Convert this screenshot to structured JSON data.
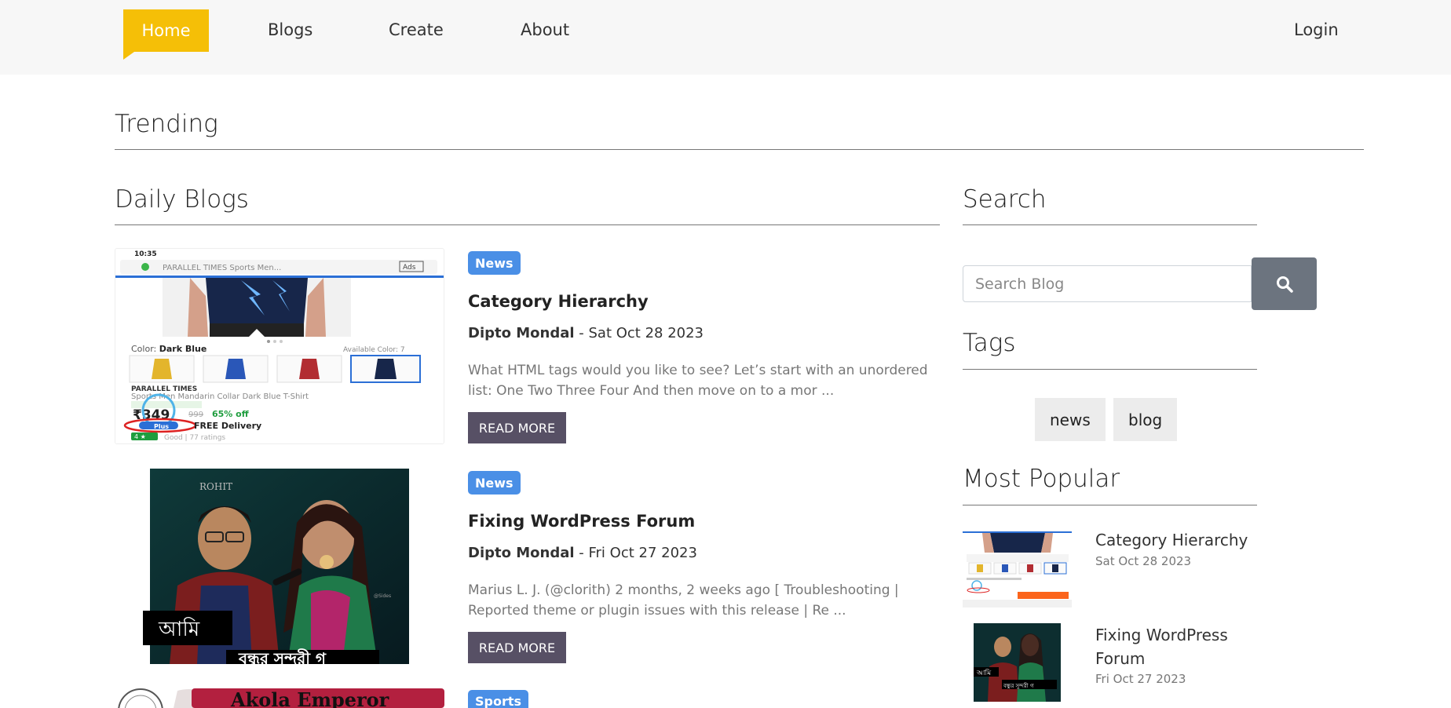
{
  "nav": {
    "home": "Home",
    "blogs": "Blogs",
    "create": "Create",
    "about": "About",
    "login": "Login"
  },
  "trending": {
    "title": "Trending"
  },
  "daily_blogs": {
    "title": "Daily Blogs",
    "posts": [
      {
        "category": "News",
        "title": "Category Hierarchy",
        "author": "Dipto Mondal",
        "date": "Sat Oct 28 2023",
        "excerpt": "What HTML tags would you like to see? Let’s start with an unordered list: One Two Three Four And then move on to a mor ...",
        "read_more": "READ MORE",
        "thumb": {
          "status_time": "10:35",
          "url_bar": "PARALLEL TIMES Sports Men...",
          "ads": "Ads",
          "color_label": "Color:",
          "color_value": "Dark Blue",
          "available": "Available Color: 7",
          "brand": "PARALLEL TIMES",
          "product": "Sports Men Mandarin Collar Dark Blue T-Shirt",
          "price": "₹349",
          "old_price": "999",
          "discount": "65% off",
          "plus": "Plus",
          "delivery": "FREE Delivery",
          "rating": "4 ★",
          "rating_text": "Good | 77 ratings"
        }
      },
      {
        "category": "News",
        "title": "Fixing WordPress Forum",
        "author": "Dipto Mondal",
        "date": "Fri Oct 27 2023",
        "excerpt": "Marius L. J. (@clorith) 2 months, 2 weeks ago [ Troubleshooting | Reported theme or plugin issues with this release | Re ...",
        "read_more": "READ MORE",
        "thumb": {
          "watermark": "ROHIT",
          "caption1": "আমি",
          "caption2": "বন্ধুর সুন্দরী গ"
        }
      },
      {
        "category": "Sports",
        "thumb": {
          "banner": "Akola Emperor"
        }
      }
    ]
  },
  "sidebar": {
    "search": {
      "title": "Search",
      "placeholder": "Search Blog",
      "icon": "search-icon"
    },
    "tags": {
      "title": "Tags",
      "items": [
        "news",
        "blog"
      ]
    },
    "popular": {
      "title": "Most Popular",
      "items": [
        {
          "title": "Category Hierarchy",
          "date": "Sat Oct 28 2023"
        },
        {
          "title": "Fixing WordPress Forum",
          "date": "Fri Oct 27 2023"
        }
      ]
    }
  },
  "colors": {
    "accent": "#f5bf07",
    "badge": "#4a8fe6",
    "button": "#575065",
    "search_button": "#6c747f"
  }
}
